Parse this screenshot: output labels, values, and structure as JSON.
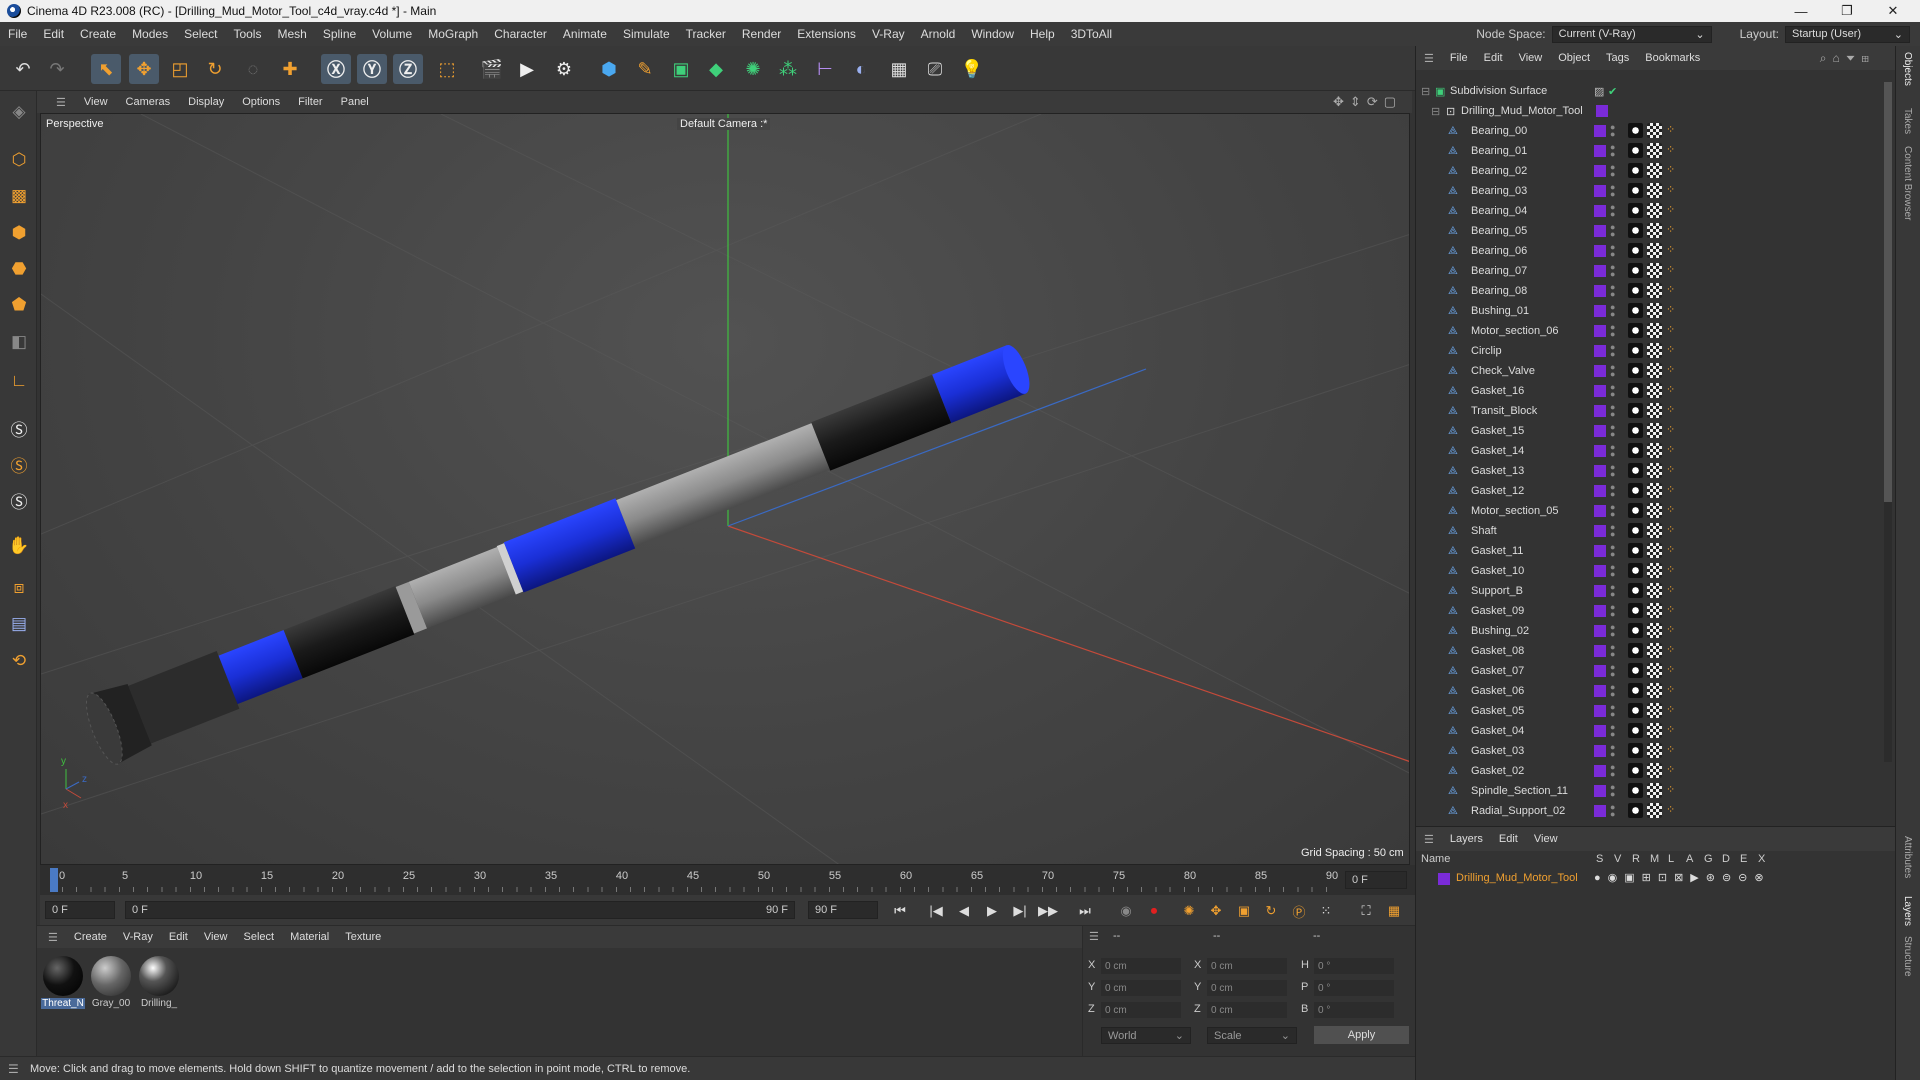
{
  "window": {
    "title": "Cinema 4D R23.008 (RC) - [Drilling_Mud_Motor_Tool_c4d_vray.c4d *] - Main",
    "minimize": "—",
    "maximize": "❐",
    "close": "✕"
  },
  "menubar": {
    "items": [
      "File",
      "Edit",
      "Create",
      "Modes",
      "Select",
      "Tools",
      "Mesh",
      "Spline",
      "Volume",
      "MoGraph",
      "Character",
      "Animate",
      "Simulate",
      "Tracker",
      "Render",
      "Extensions",
      "V-Ray",
      "Arnold",
      "Window",
      "Help",
      "3DToAll"
    ],
    "node_space_label": "Node Space:",
    "node_space_value": "Current (V-Ray)",
    "layout_label": "Layout:",
    "layout_value": "Startup (User)"
  },
  "toolbar": {
    "icons": [
      "undo-icon",
      "redo-icon",
      "live-selection-icon",
      "move-icon",
      "scale-icon",
      "rotate-icon",
      "recent-tool-icon",
      "add-icon",
      "x-axis-icon",
      "y-axis-icon",
      "z-axis-icon",
      "coordinate-system-icon",
      "render-view-icon",
      "render-picture-viewer-icon",
      "render-settings-icon",
      "cube-icon",
      "pen-icon",
      "subdivision-icon",
      "extrude-icon",
      "cloner-icon",
      "mograph-icon",
      "deformer-icon",
      "field-icon",
      "floor-icon",
      "camera-icon",
      "light-icon"
    ]
  },
  "viewport": {
    "menu": [
      "View",
      "Cameras",
      "Display",
      "Options",
      "Filter",
      "Panel"
    ],
    "view_name": "Perspective",
    "camera_name": "Default Camera :*",
    "grid_spacing": "Grid Spacing : 50 cm",
    "axis_x": "x",
    "axis_y": "y",
    "axis_z": "z",
    "colors": {
      "blue": "#1a2fd6",
      "black": "#1a1a1a",
      "gray": "#8a8a8a",
      "axis_green": "#3fbf3f",
      "axis_red": "#c44a3a",
      "axis_blue": "#3a6ac4"
    }
  },
  "timeline": {
    "ticks": [
      "0",
      "5",
      "10",
      "15",
      "20",
      "25",
      "30",
      "35",
      "40",
      "45",
      "50",
      "55",
      "60",
      "65",
      "70",
      "75",
      "80",
      "85",
      "90"
    ],
    "current_frame": "0 F"
  },
  "transport": {
    "start_field": "0 F",
    "range_start": "0 F",
    "range_end": "90 F",
    "end_field": "90 F"
  },
  "material_panel": {
    "menu": [
      "Create",
      "V-Ray",
      "Edit",
      "View",
      "Select",
      "Material",
      "Texture"
    ],
    "materials": [
      {
        "name": "Threat_N",
        "selected": true
      },
      {
        "name": "Gray_00",
        "selected": false
      },
      {
        "name": "Drilling_",
        "selected": false
      }
    ]
  },
  "coord_panel": {
    "headers": [
      "--",
      "--",
      "--"
    ],
    "rows": [
      {
        "a": "X",
        "av": "0 cm",
        "b": "X",
        "bv": "0 cm",
        "c": "H",
        "cv": "0 °"
      },
      {
        "a": "Y",
        "av": "0 cm",
        "b": "Y",
        "bv": "0 cm",
        "c": "P",
        "cv": "0 °"
      },
      {
        "a": "Z",
        "av": "0 cm",
        "b": "Z",
        "bv": "0 cm",
        "c": "B",
        "cv": "0 °"
      }
    ],
    "world": "World",
    "scale": "Scale",
    "apply": "Apply"
  },
  "status": {
    "text": "Move: Click and drag to move elements. Hold down SHIFT to quantize movement / add to the selection in point mode, CTRL to remove."
  },
  "object_manager": {
    "menu": [
      "File",
      "Edit",
      "View",
      "Object",
      "Tags",
      "Bookmarks"
    ],
    "root": "Subdivision Surface",
    "group": "Drilling_Mud_Motor_Tool",
    "items": [
      "Bearing_00",
      "Bearing_01",
      "Bearing_02",
      "Bearing_03",
      "Bearing_04",
      "Bearing_05",
      "Bearing_06",
      "Bearing_07",
      "Bearing_08",
      "Bushing_01",
      "Motor_section_06",
      "Circlip",
      "Check_Valve",
      "Gasket_16",
      "Transit_Block",
      "Gasket_15",
      "Gasket_14",
      "Gasket_13",
      "Gasket_12",
      "Motor_section_05",
      "Shaft",
      "Gasket_11",
      "Gasket_10",
      "Support_B",
      "Gasket_09",
      "Bushing_02",
      "Gasket_08",
      "Gasket_07",
      "Gasket_06",
      "Gasket_05",
      "Gasket_04",
      "Gasket_03",
      "Gasket_02",
      "Spindle_Section_11",
      "Radial_Support_02"
    ]
  },
  "layer_manager": {
    "menu": [
      "Layers",
      "Edit",
      "View"
    ],
    "name_header": "Name",
    "columns": [
      "S",
      "V",
      "R",
      "M",
      "L",
      "A",
      "G",
      "D",
      "E",
      "X"
    ],
    "layer_name": "Drilling_Mud_Motor_Tool",
    "layer_color": "#7a2bd8"
  },
  "side_tabs": [
    "Objects",
    "Takes",
    "Content Browser",
    "Attributes",
    "Layers",
    "Structure"
  ]
}
